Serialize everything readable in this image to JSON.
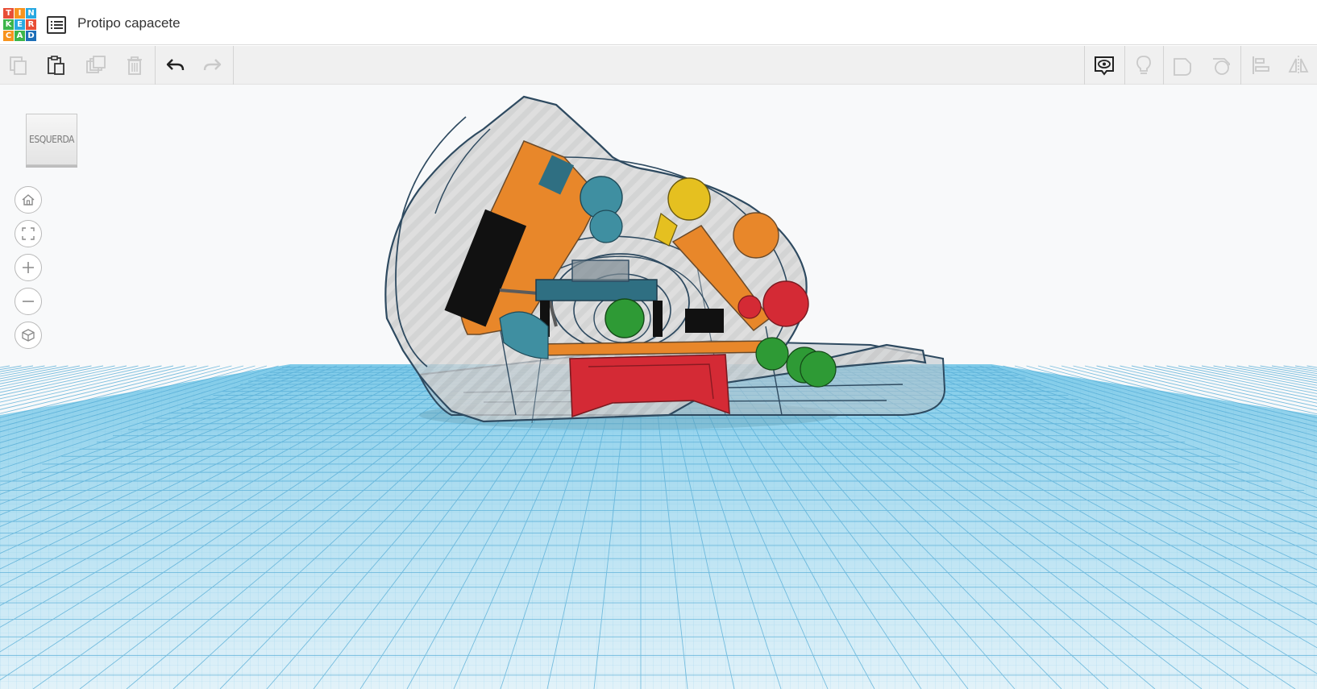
{
  "app": {
    "logo_letters": [
      "T",
      "I",
      "N",
      "K",
      "E",
      "R",
      "C",
      "A",
      "D"
    ],
    "logo_colors": [
      "#e84e36",
      "#f7931e",
      "#29a9e1",
      "#3cb54a",
      "#29a9e1",
      "#e84e36",
      "#f7931e",
      "#3cb54a",
      "#1d6fb8"
    ]
  },
  "header": {
    "title": "Protipo capacete",
    "designs_icon": "list-icon"
  },
  "toolbar": {
    "items": [
      {
        "name": "copy",
        "icon": "copy-icon",
        "enabled": false
      },
      {
        "name": "paste",
        "icon": "paste-icon",
        "enabled": true
      },
      {
        "name": "duplicate",
        "icon": "duplicate-icon",
        "enabled": false
      },
      {
        "name": "delete",
        "icon": "trash-icon",
        "enabled": false
      },
      {
        "name": "undo",
        "icon": "undo-icon",
        "enabled": true
      },
      {
        "name": "redo",
        "icon": "redo-icon",
        "enabled": false
      }
    ],
    "right_items": [
      {
        "name": "notes",
        "icon": "note-eye-icon",
        "enabled": true
      },
      {
        "name": "light",
        "icon": "lightbulb-icon",
        "enabled": false
      },
      {
        "name": "group-shape",
        "icon": "shape-icon",
        "enabled": false
      },
      {
        "name": "hole-shape",
        "icon": "hole-shape-icon",
        "enabled": false
      },
      {
        "name": "align",
        "icon": "align-icon",
        "enabled": false
      },
      {
        "name": "mirror",
        "icon": "mirror-icon",
        "enabled": false
      }
    ]
  },
  "viewcube": {
    "face_label": "ESQUERDA"
  },
  "nav_controls": [
    {
      "name": "home-view",
      "icon": "home-icon"
    },
    {
      "name": "fit-view",
      "icon": "fit-icon"
    },
    {
      "name": "zoom-in",
      "icon": "plus-icon"
    },
    {
      "name": "zoom-out",
      "icon": "minus-icon"
    },
    {
      "name": "perspective",
      "icon": "cube-icon"
    }
  ],
  "colors": {
    "workplane": "#8fd0ea",
    "grid_line": "#5bb2da",
    "shell_outline": "#2e4a60",
    "orange_board": "#e8872a",
    "red_part": "#d42a35",
    "teal": "#3f8fa1",
    "yellow": "#e5c020",
    "green": "#2e9a35"
  }
}
